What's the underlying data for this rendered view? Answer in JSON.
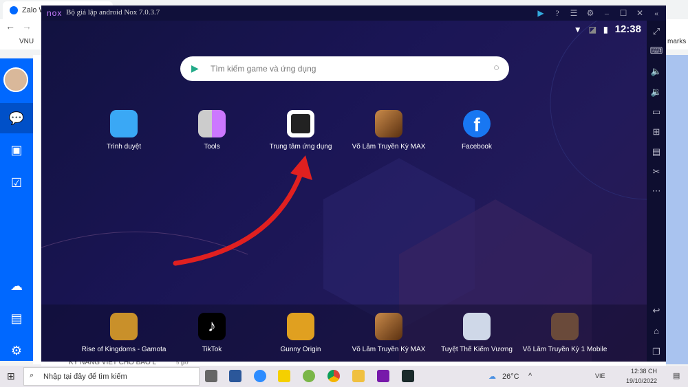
{
  "browser": {
    "tab_title": "Zalo W",
    "bookmark": "VNU",
    "bookmarks_tail": "marks"
  },
  "zalo": {
    "sidebar_icons": [
      "avatar",
      "chat-icon",
      "contacts-icon",
      "todo-icon",
      "cloud-icon",
      "briefcase-icon",
      "gear-icon"
    ],
    "preview_text": "KỸ NĂNG VIẾT CHO BẢO L",
    "preview_time": "5 giờ"
  },
  "nox": {
    "logo": "nox",
    "title": "Bộ giả lập android Nox 7.0.3.7",
    "status_time": "12:38",
    "search_placeholder": "Tìm kiếm game và ứng dụng",
    "apps": [
      {
        "label": "Trình duyệt",
        "color": "#3aa8f5"
      },
      {
        "label": "Tools",
        "color": "#d0d0d8"
      },
      {
        "label": "Trung tâm ứng dụng",
        "color": "#ffffff"
      },
      {
        "label": "Võ Lâm Truyền Kỳ MAX",
        "color": "#8a5a2a"
      },
      {
        "label": "Facebook",
        "color": "#1877f2"
      }
    ],
    "dock": [
      {
        "label": "Rise of Kingdoms - Gamota",
        "color": "#c9902a"
      },
      {
        "label": "TikTok",
        "color": "#000000"
      },
      {
        "label": "Gunny Origin",
        "color": "#e0a020"
      },
      {
        "label": "Võ Lâm Truyền Kỳ MAX",
        "color": "#8a5a2a"
      },
      {
        "label": "Tuyệt Thế Kiếm Vương",
        "color": "#cfd8e8"
      },
      {
        "label": "Võ Lâm Truyền Kỳ 1 Mobile",
        "color": "#6a4a3a"
      }
    ],
    "arrow_color": "#e02020"
  },
  "taskbar": {
    "search_placeholder": "Nhập tại đây để tìm kiếm",
    "weather": "26°C",
    "lang": "VIE",
    "time": "12:38 CH",
    "date": "19/10/2022"
  }
}
